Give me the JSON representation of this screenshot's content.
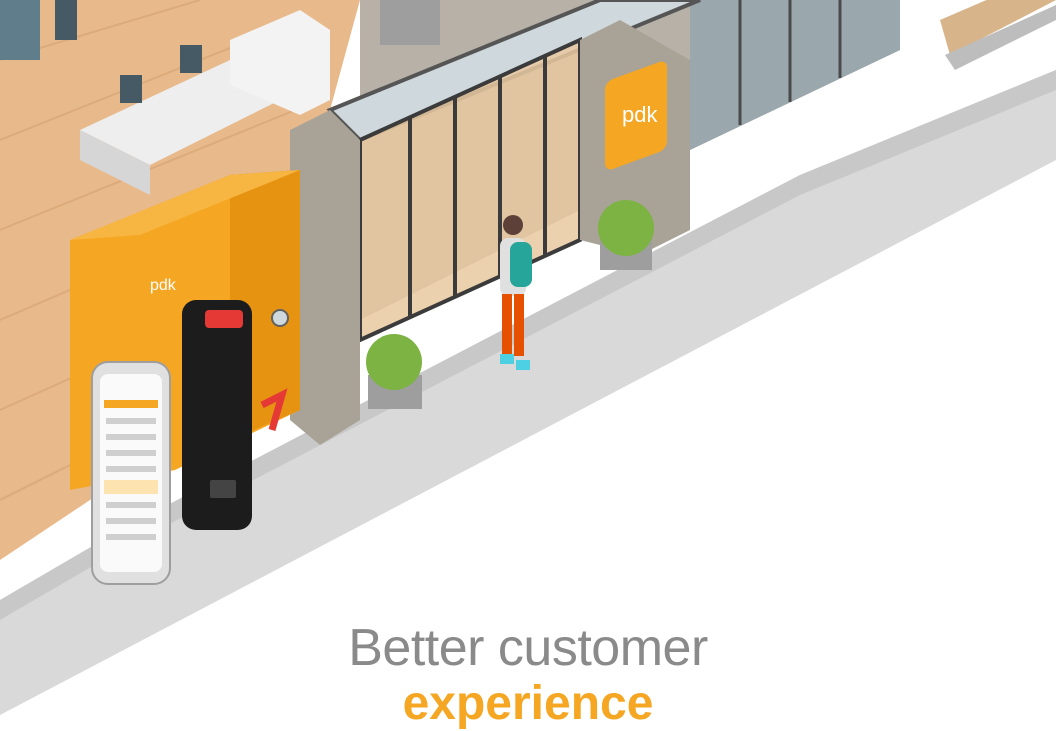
{
  "illustration": {
    "storefront_logo_text": "pdk",
    "cabinet_logo_text": "pdk",
    "reader_led_color": "#e53935",
    "brand_color": "#f5a623",
    "cabinet_mark_color": "#e53935"
  },
  "headline": {
    "line1": "Better customer",
    "line2": "experience"
  }
}
